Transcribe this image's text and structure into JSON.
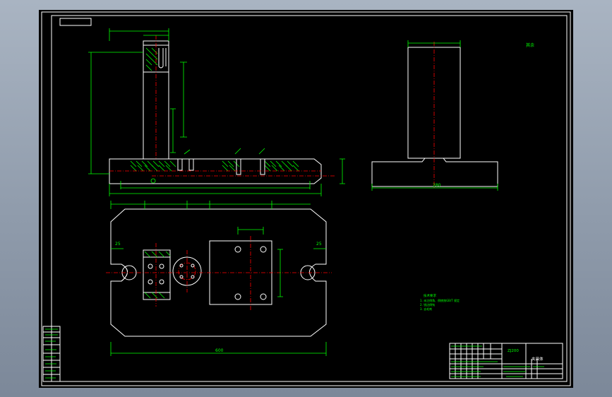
{
  "drawing": {
    "top_view_overall_dim": "280",
    "plan_view_overall_dim": "600",
    "left_notch_dim": "25",
    "right_notch_dim": "25",
    "side_view_tag": "其余",
    "tech_requirements_title": "技术要求",
    "tech_requirements": [
      "1. 未注倒角、倒棱按GB/T 规定",
      "2. 锐边倒钝",
      "3. 去毛刺"
    ]
  },
  "title_block": {
    "drawing_number": "ZJ200",
    "part_name": "夹具体"
  }
}
